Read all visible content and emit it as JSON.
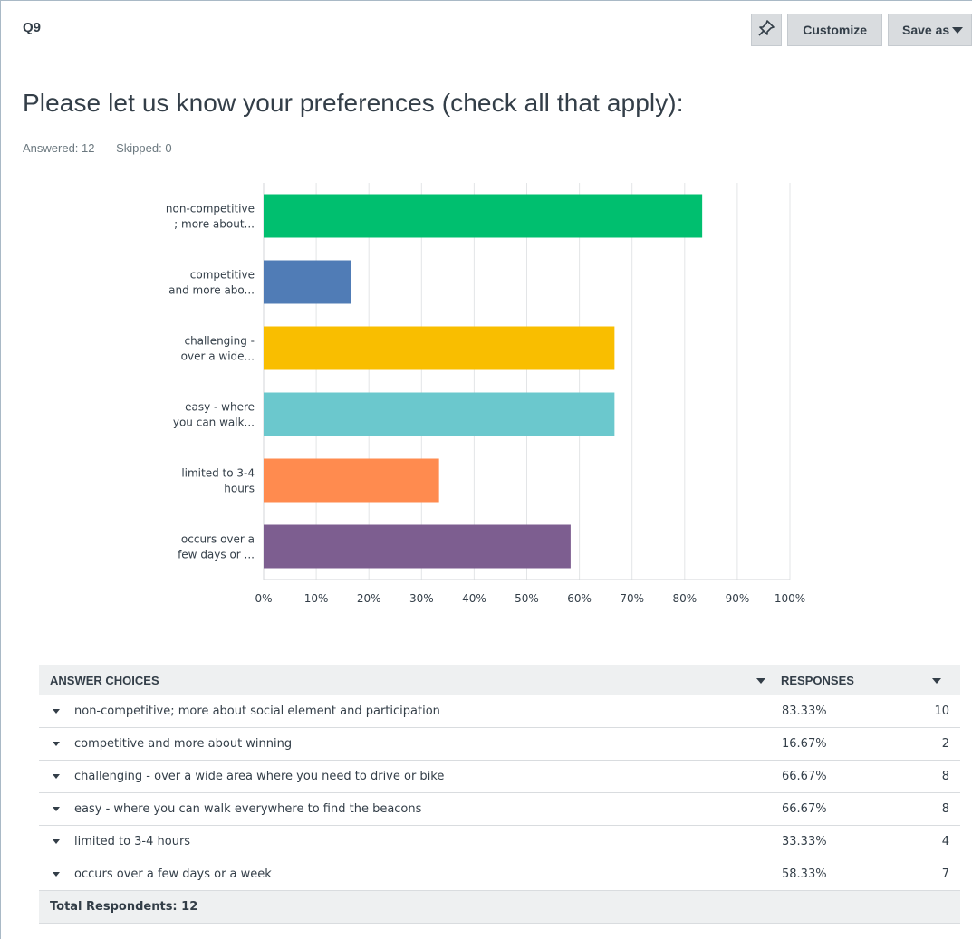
{
  "question_number": "Q9",
  "toolbar": {
    "pin_icon": "pin-icon",
    "customize_label": "Customize",
    "save_as_label": "Save as"
  },
  "question_title": "Please let us know your preferences (check all that apply):",
  "stats": {
    "answered": "Answered: 12",
    "skipped": "Skipped: 0"
  },
  "chart_data": {
    "type": "bar",
    "orientation": "horizontal",
    "categories": [
      [
        "non-competitive",
        "; more about..."
      ],
      [
        "competitive",
        "and more abo..."
      ],
      [
        "challenging -",
        "over a wide..."
      ],
      [
        "easy - where",
        "you can walk..."
      ],
      [
        "limited to 3-4",
        "hours"
      ],
      [
        "occurs over a",
        "few days or ..."
      ]
    ],
    "values": [
      83.33,
      16.67,
      66.67,
      66.67,
      33.33,
      58.33
    ],
    "colors": [
      "#00bf6f",
      "#507cb6",
      "#f9be00",
      "#6bc8cd",
      "#ff8b4f",
      "#7d5e90"
    ],
    "xlim": [
      0,
      100
    ],
    "xticks": [
      "0%",
      "10%",
      "20%",
      "30%",
      "40%",
      "50%",
      "60%",
      "70%",
      "80%",
      "90%",
      "100%"
    ],
    "grid": true
  },
  "table": {
    "header_choices": "ANSWER CHOICES",
    "header_responses": "RESPONSES",
    "rows": [
      {
        "choice": "non-competitive; more about social element and participation",
        "percent": "83.33%",
        "count": "10"
      },
      {
        "choice": "competitive and more about winning",
        "percent": "16.67%",
        "count": "2"
      },
      {
        "choice": "challenging - over a wide area where you need to drive or bike",
        "percent": "66.67%",
        "count": "8"
      },
      {
        "choice": "easy - where you can walk everywhere to find the beacons",
        "percent": "66.67%",
        "count": "8"
      },
      {
        "choice": "limited to 3-4 hours",
        "percent": "33.33%",
        "count": "4"
      },
      {
        "choice": "occurs over a few days or a week",
        "percent": "58.33%",
        "count": "7"
      }
    ],
    "total": "Total Respondents: 12"
  }
}
